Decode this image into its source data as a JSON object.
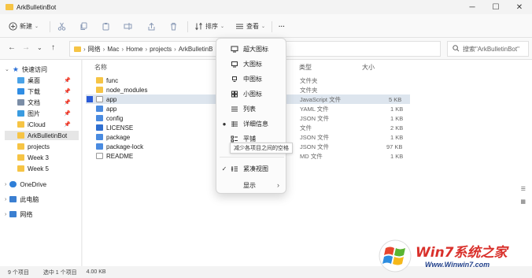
{
  "window": {
    "title": "ArkBulletinBot"
  },
  "toolbar": {
    "new_label": "新建",
    "sort_label": "排序",
    "view_label": "查看",
    "more_label": "···"
  },
  "address": {
    "path": [
      "网络",
      "Mac",
      "Home",
      "projects",
      "ArkBulletinB"
    ],
    "search_placeholder": "搜索\"ArkBulletinBot\""
  },
  "sidebar": {
    "items": [
      {
        "label": "快速访问",
        "icon": "star-icon",
        "pinned": false
      },
      {
        "label": "桌面",
        "icon": "desktop-icon",
        "pinned": true
      },
      {
        "label": "下载",
        "icon": "download-icon",
        "pinned": true
      },
      {
        "label": "文档",
        "icon": "document-icon",
        "pinned": true
      },
      {
        "label": "图片",
        "icon": "pictures-icon",
        "pinned": true
      },
      {
        "label": "iCloud",
        "icon": "folder-icon",
        "pinned": true
      },
      {
        "label": "ArkBulletinBot",
        "icon": "folder-icon",
        "pinned": false
      },
      {
        "label": "projects",
        "icon": "folder-icon",
        "pinned": false
      },
      {
        "label": "Week 3",
        "icon": "folder-icon",
        "pinned": false
      },
      {
        "label": "Week 5",
        "icon": "folder-icon",
        "pinned": false
      },
      {
        "label": "OneDrive",
        "icon": "cloud-icon",
        "pinned": false
      },
      {
        "label": "此电脑",
        "icon": "pc-icon",
        "pinned": false
      },
      {
        "label": "网络",
        "icon": "network-icon",
        "pinned": false
      }
    ]
  },
  "columns": {
    "name": "名称",
    "type": "类型",
    "size": "大小"
  },
  "files": [
    {
      "name": "func",
      "type": "文件夹",
      "size": "",
      "icon": "folder-icon"
    },
    {
      "name": "node_modules",
      "type": "文件夹",
      "size": "",
      "icon": "folder-icon"
    },
    {
      "name": "app",
      "type": "JavaScript 文件",
      "size": "5 KB",
      "icon": "js-file-icon",
      "selected": true
    },
    {
      "name": "app",
      "type": "YAML 文件",
      "size": "1 KB",
      "icon": "yaml-file-icon"
    },
    {
      "name": "config",
      "type": "JSON 文件",
      "size": "1 KB",
      "icon": "json-file-icon"
    },
    {
      "name": "LICENSE",
      "type": "文件",
      "size": "2 KB",
      "icon": "file-icon"
    },
    {
      "name": "package",
      "type": "JSON 文件",
      "size": "1 KB",
      "icon": "json-file-icon"
    },
    {
      "name": "package-lock",
      "type": "JSON 文件",
      "size": "97 KB",
      "icon": "json-file-icon"
    },
    {
      "name": "README",
      "type": "MD 文件",
      "size": "1 KB",
      "icon": "file-icon"
    }
  ],
  "view_menu": {
    "items": [
      {
        "label": "超大图标",
        "icon": "monitor-icon",
        "checked": false
      },
      {
        "label": "大图标",
        "icon": "monitor-icon",
        "checked": false
      },
      {
        "label": "中图标",
        "icon": "monitor-small-icon",
        "checked": false
      },
      {
        "label": "小图标",
        "icon": "grid-icon",
        "checked": false
      },
      {
        "label": "列表",
        "icon": "list-icon",
        "checked": false
      },
      {
        "label": "详细信息",
        "icon": "details-icon",
        "checked": true
      },
      {
        "label": "平铺",
        "icon": "tiles-icon",
        "checked": false
      },
      {
        "label": "紧凑视图",
        "icon": "compact-icon",
        "checked": true,
        "tick": true
      },
      {
        "label": "显示",
        "icon": "",
        "submenu": true
      }
    ],
    "tooltip": "减少各项目之间的空格"
  },
  "status": {
    "count": "9 个项目",
    "selection": "选中 1 个项目",
    "size": "4.00 KB"
  },
  "watermark": {
    "brand": "Win7系统之家",
    "url": "Www.Winwin7.com"
  },
  "colors": {
    "accent": "#2a5bd7",
    "folder": "#f6c445"
  }
}
